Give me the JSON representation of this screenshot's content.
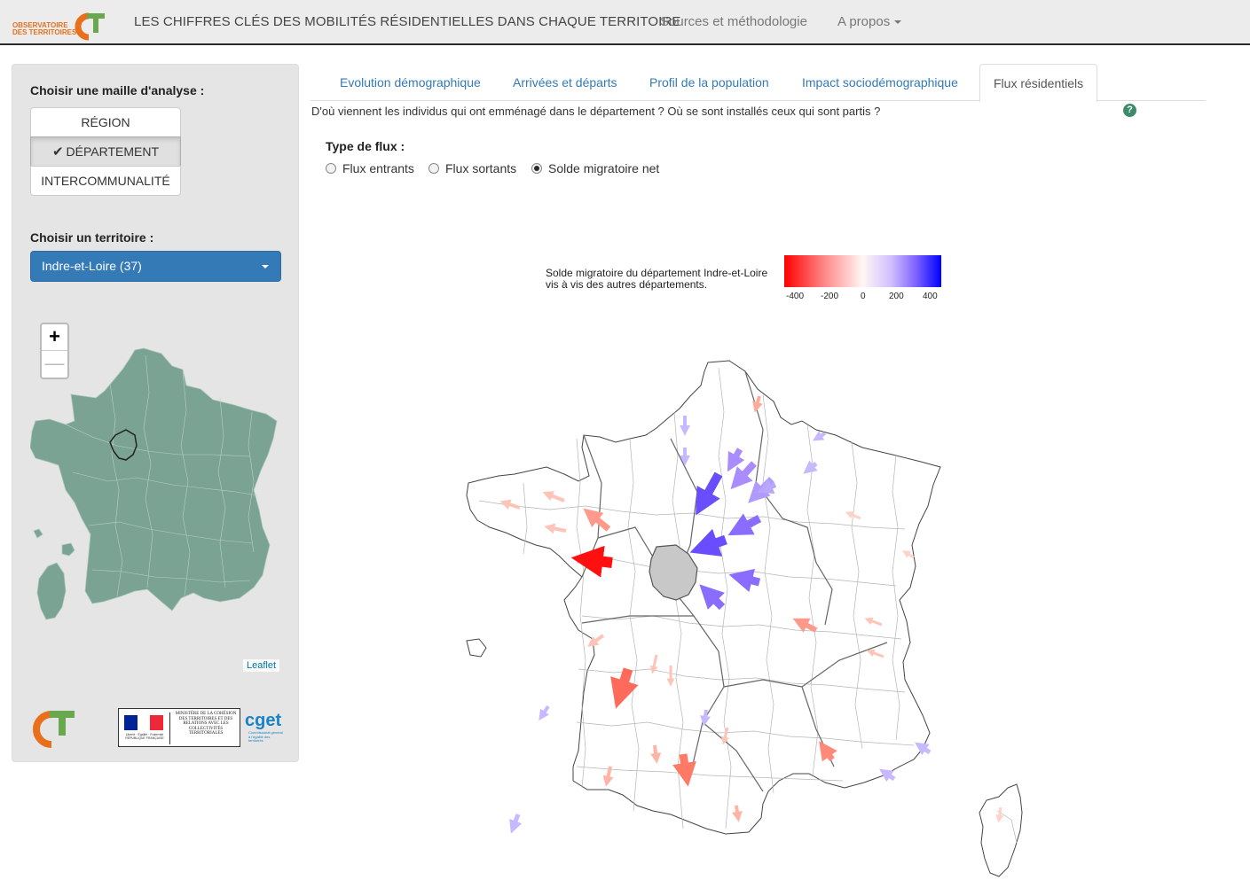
{
  "header": {
    "logo": "OBSERVATOIRE DES TERRITOIRES",
    "title": "LES CHIFFRES CLÉS DES MOBILITÉS RÉSIDENTIELLES DANS CHAQUE TERRITOIRE",
    "sources_link": "Sources et méthodologie",
    "apropos_link": "A propos"
  },
  "sidebar": {
    "maille_heading": "Choisir une maille d'analyse :",
    "maille_options": [
      "RÉGION",
      "DÉPARTEMENT",
      "INTERCOMMUNALITÉ"
    ],
    "maille_selected": "DÉPARTEMENT",
    "territoire_heading": "Choisir un territoire :",
    "territoire_selected": "Indre-et-Loire (37)",
    "zoom_in": "+",
    "zoom_out": "—",
    "map_attribution": "Leaflet",
    "gov_republic": "Liberté · Égalité · Fraternité RÉPUBLIQUE FRANÇAISE",
    "gov_ministry": "MINISTÈRE DE LA COHÉSION DES TERRITOIRES ET DES RELATIONS AVEC LES COLLECTIVITÉS TERRITORIALES",
    "cget_logo": "cget",
    "cget_sub": "Commissariat général à l'égalité des territoires"
  },
  "tabs": [
    "Evolution démographique",
    "Arrivées et départs",
    "Profil de la population",
    "Impact sociodémographique",
    "Flux résidentiels"
  ],
  "active_tab": "Flux résidentiels",
  "main": {
    "question": "D'où viennent les individus qui ont emménagé dans le département ? Où se sont installés ceux qui sont partis ?",
    "help_icon": "?",
    "flux_type_label": "Type de flux :",
    "flux_options": [
      "Flux entrants",
      "Flux sortants",
      "Solde migratoire net"
    ],
    "flux_selected": "Solde migratoire net"
  },
  "legend": {
    "title_line1": "Solde migratoire du département Indre-et-Loire",
    "title_line2": "vis à vis des autres départements.",
    "ticks": [
      "-400",
      "-200",
      "0",
      "200",
      "400"
    ],
    "color_min": "#ff0000",
    "color_mid": "#ffffff",
    "color_max": "#0000ff"
  },
  "colors": {
    "navbar_bg": "#ececec",
    "sidebar_bg": "#e5e5e5",
    "select_bg": "#337ab7",
    "link": "#337ab7",
    "minimap_fill": "#7ba393",
    "selected_dept_fill": "#cccccc"
  },
  "icons": [
    "logo-ct-icon",
    "check-icon",
    "caret-down-icon",
    "help-icon",
    "zoom-in-icon",
    "zoom-out-icon"
  ]
}
